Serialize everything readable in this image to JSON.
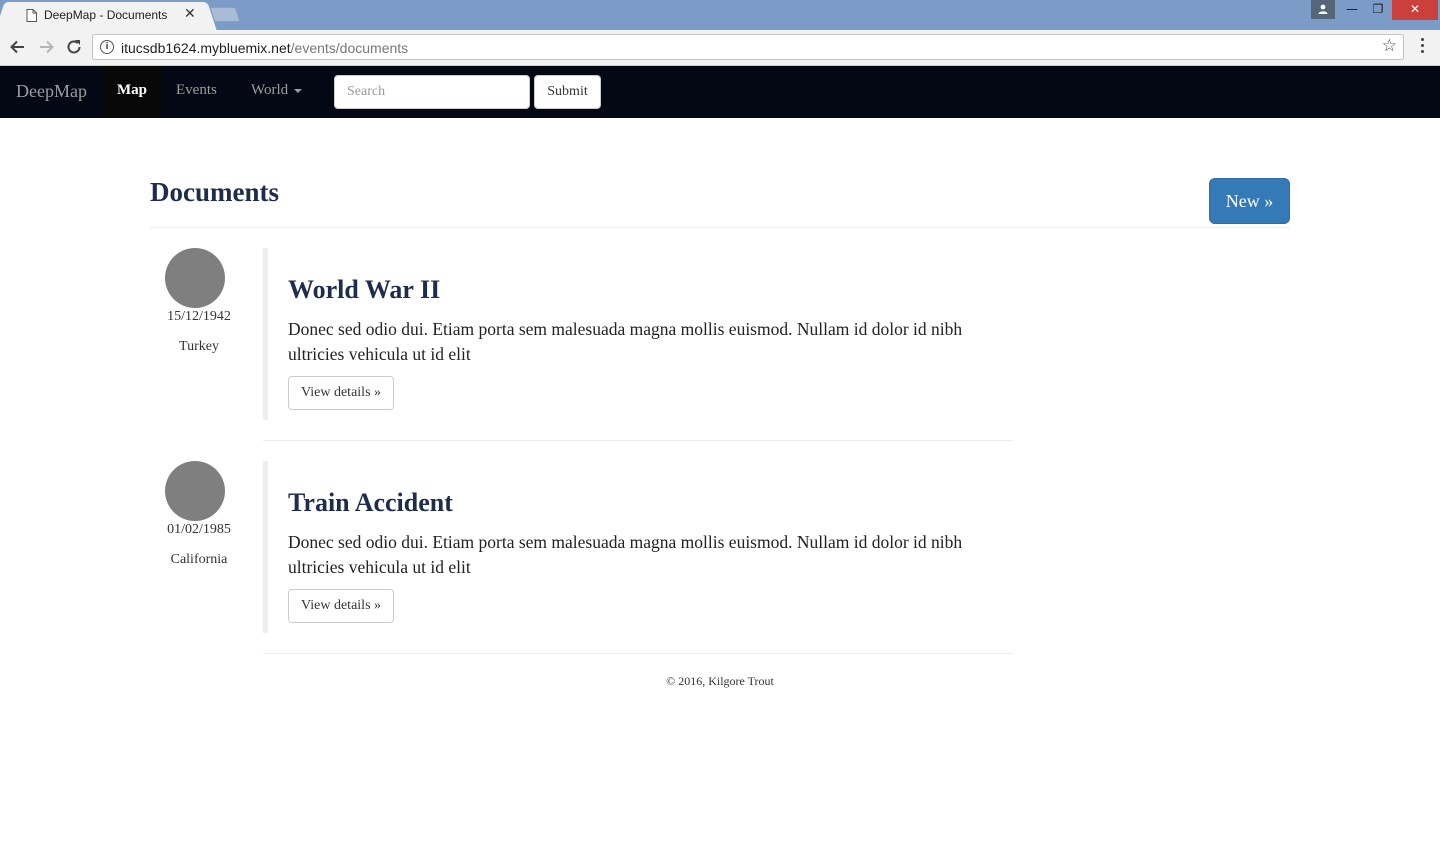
{
  "browser": {
    "tab_title": "DeepMap - Documents",
    "tab_close": "✕",
    "url_host": "itucsdb1624.mybluemix.net",
    "url_path": "/events/documents",
    "info_glyph": "i",
    "star_glyph": "☆",
    "window_controls": {
      "minimize": "—",
      "restore": "❐",
      "close": "✕"
    }
  },
  "navbar": {
    "brand": "DeepMap",
    "links": [
      {
        "label": "Map",
        "active": true
      },
      {
        "label": "Events",
        "active": false
      },
      {
        "label": "World",
        "active": false,
        "dropdown": true
      }
    ],
    "search_placeholder": "Search",
    "submit_label": "Submit"
  },
  "page": {
    "title": "Documents",
    "new_button": "New »"
  },
  "documents": [
    {
      "date": "15/12/1942",
      "place": "Turkey",
      "title": "World War II",
      "text": "Donec sed odio dui. Etiam porta sem malesuada magna mollis euismod. Nullam id dolor id nibh ultricies vehicula ut id elit",
      "button": "View details »"
    },
    {
      "date": "01/02/1985",
      "place": "California",
      "title": "Train Accident",
      "text": "Donec sed odio dui. Etiam porta sem malesuada magna mollis euismod. Nullam id dolor id nibh ultricies vehicula ut id elit",
      "button": "View details »"
    }
  ],
  "footer": {
    "text": "© 2016, Kilgore Trout"
  },
  "colors": {
    "navbar_bg": "#040815",
    "primary_button": "#337ab7",
    "heading": "#1f2d4d",
    "avatar": "#7f7f7f",
    "tabstrip": "#7a9cc6"
  }
}
